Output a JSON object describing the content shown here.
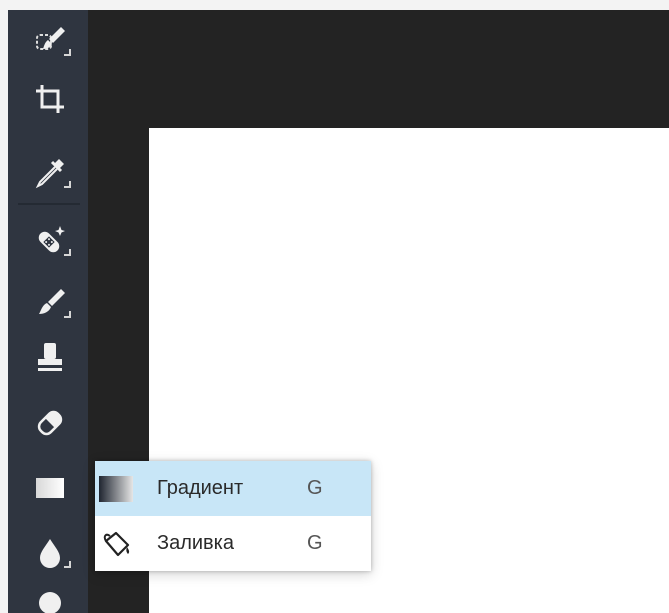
{
  "toolbar": {
    "tools": [
      {
        "icon": "lasso-brush-icon"
      },
      {
        "icon": "crop-icon"
      },
      {
        "icon": "eyedropper-icon"
      },
      {
        "icon": "healing-bandage-icon"
      },
      {
        "icon": "brush-icon"
      },
      {
        "icon": "clone-stamp-icon"
      },
      {
        "icon": "eraser-icon"
      },
      {
        "icon": "gradient-icon"
      },
      {
        "icon": "blur-drop-icon"
      },
      {
        "icon": "dodge-icon"
      }
    ]
  },
  "flyout": {
    "items": [
      {
        "label": "Градиент",
        "shortcut": "G",
        "icon": "gradient-swatch-icon",
        "active": true
      },
      {
        "label": "Заливка",
        "shortcut": "G",
        "icon": "paint-bucket-icon",
        "active": false
      }
    ]
  },
  "colors": {
    "toolbar_bg": "#2f3540",
    "workspace_bg": "#232323",
    "canvas_bg": "#ffffff",
    "menu_active_bg": "#c8e6f7"
  }
}
